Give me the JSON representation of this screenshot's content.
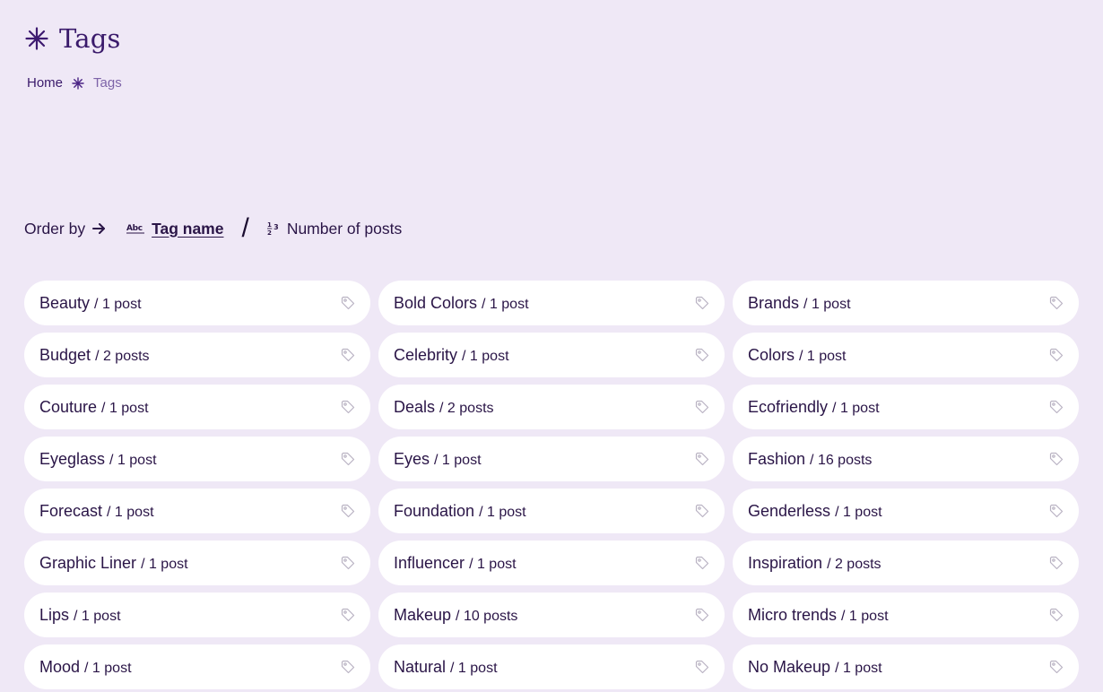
{
  "page": {
    "title": "Tags",
    "icon": "sparkle-icon"
  },
  "breadcrumb": {
    "home": "Home",
    "current": "Tags"
  },
  "order_by": {
    "label": "Order by",
    "options": [
      {
        "icon_text": "Abc",
        "label": "Tag name",
        "active": true
      },
      {
        "icon_text": "1/2 3",
        "label": "Number of posts",
        "active": false
      }
    ]
  },
  "tags": [
    {
      "name": "Beauty",
      "count": "/ 1 post"
    },
    {
      "name": "Bold Colors",
      "count": "/ 1 post"
    },
    {
      "name": "Brands",
      "count": "/ 1 post"
    },
    {
      "name": "Budget",
      "count": "/ 2 posts"
    },
    {
      "name": "Celebrity",
      "count": "/ 1 post"
    },
    {
      "name": "Colors",
      "count": "/ 1 post"
    },
    {
      "name": "Couture",
      "count": "/ 1 post"
    },
    {
      "name": "Deals",
      "count": "/ 2 posts"
    },
    {
      "name": "Ecofriendly",
      "count": "/ 1 post"
    },
    {
      "name": "Eyeglass",
      "count": "/ 1 post"
    },
    {
      "name": "Eyes",
      "count": "/ 1 post"
    },
    {
      "name": "Fashion",
      "count": "/ 16 posts"
    },
    {
      "name": "Forecast",
      "count": "/ 1 post"
    },
    {
      "name": "Foundation",
      "count": "/ 1 post"
    },
    {
      "name": "Genderless",
      "count": "/ 1 post"
    },
    {
      "name": "Graphic Liner",
      "count": "/ 1 post"
    },
    {
      "name": "Influencer",
      "count": "/ 1 post"
    },
    {
      "name": "Inspiration",
      "count": "/ 2 posts"
    },
    {
      "name": "Lips",
      "count": "/ 1 post"
    },
    {
      "name": "Makeup",
      "count": "/ 10 posts"
    },
    {
      "name": "Micro trends",
      "count": "/ 1 post"
    },
    {
      "name": "Mood",
      "count": "/ 1 post"
    },
    {
      "name": "Natural",
      "count": "/ 1 post"
    },
    {
      "name": "No Makeup",
      "count": "/ 1 post"
    }
  ],
  "colors": {
    "background": "#efe8f6",
    "accent": "#3a1a6b",
    "pill": "#ffffff",
    "tag_icon": "#b9b2c2"
  }
}
